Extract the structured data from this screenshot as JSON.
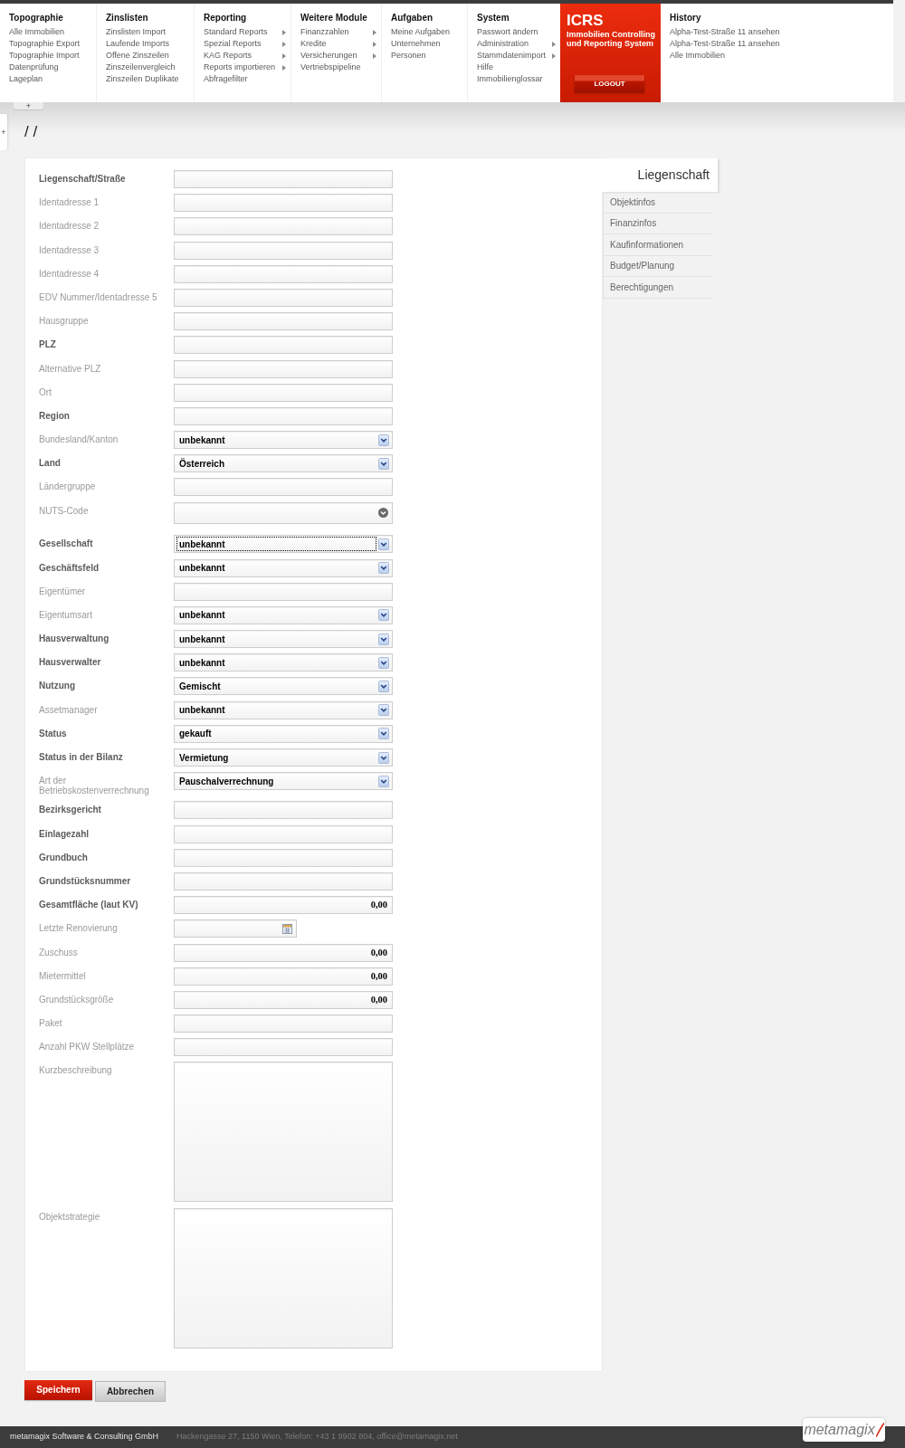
{
  "menu": {
    "columns": [
      {
        "title": "Topographie",
        "items": [
          {
            "label": "Alle Immobilien",
            "submenu": false
          },
          {
            "label": "Topographie Export",
            "submenu": false
          },
          {
            "label": "Topographie Import",
            "submenu": false
          },
          {
            "label": "Datenprüfung",
            "submenu": false
          },
          {
            "label": "Lageplan",
            "submenu": false
          }
        ]
      },
      {
        "title": "Zinslisten",
        "items": [
          {
            "label": "Zinslisten Import",
            "submenu": false
          },
          {
            "label": "Laufende Imports",
            "submenu": false
          },
          {
            "label": "Offene Zinszeilen",
            "submenu": false
          },
          {
            "label": "Zinszeilenvergleich",
            "submenu": false
          },
          {
            "label": "Zinszeilen Duplikate",
            "submenu": false
          }
        ]
      },
      {
        "title": "Reporting",
        "items": [
          {
            "label": "Standard Reports",
            "submenu": true
          },
          {
            "label": "Spezial Reports",
            "submenu": true
          },
          {
            "label": "KAG Reports",
            "submenu": true
          },
          {
            "label": "Reports importieren",
            "submenu": true
          },
          {
            "label": "Abfragefilter",
            "submenu": false
          }
        ]
      },
      {
        "title": "Weitere Module",
        "items": [
          {
            "label": "Finanzzahlen",
            "submenu": true
          },
          {
            "label": "Kredite",
            "submenu": true
          },
          {
            "label": "Versicherungen",
            "submenu": true
          },
          {
            "label": "Vertriebspipeline",
            "submenu": false
          }
        ]
      },
      {
        "title": "Aufgaben",
        "items": [
          {
            "label": "Meine Aufgaben",
            "submenu": false
          },
          {
            "label": "Unternehmen",
            "submenu": false
          },
          {
            "label": "Personen",
            "submenu": false
          }
        ]
      },
      {
        "title": "System",
        "items": [
          {
            "label": "Passwort ändern",
            "submenu": false
          },
          {
            "label": "Administration",
            "submenu": true
          },
          {
            "label": "Stammdatenimport",
            "submenu": true
          },
          {
            "label": "Hilfe",
            "submenu": false
          },
          {
            "label": "Immobilienglossar",
            "submenu": false
          }
        ]
      }
    ],
    "brand": {
      "title": "ICRS",
      "subtitle": "Immobilien Controlling und Reporting System",
      "logout": "LOGOUT"
    },
    "history": {
      "title": "History",
      "items": [
        "Alpha-Test-Straße 11 ansehen",
        "Alpha-Test-Straße 11 ansehen",
        "Alle Immobilien"
      ]
    }
  },
  "add_tab": "+",
  "side_tab": "+",
  "breadcrumb": "/ /",
  "form": {
    "fields": [
      {
        "label": "Liegenschaft/Straße",
        "kind": "text",
        "required": true,
        "focused": false
      },
      {
        "label": "Identadresse 1",
        "kind": "text",
        "required": false,
        "focused": false
      },
      {
        "label": "Identadresse 2",
        "kind": "text",
        "required": false,
        "focused": false
      },
      {
        "label": "Identadresse 3",
        "kind": "text",
        "required": false,
        "focused": false
      },
      {
        "label": "Identadresse 4",
        "kind": "text",
        "required": false,
        "focused": false
      },
      {
        "label": "EDV Nummer/Identadresse 5",
        "kind": "text",
        "required": false,
        "focused": false
      },
      {
        "label": "Hausgruppe",
        "kind": "text",
        "required": false,
        "focused": false
      },
      {
        "label": "PLZ",
        "kind": "text",
        "required": true,
        "focused": false
      },
      {
        "label": "Alternative PLZ",
        "kind": "text",
        "required": false,
        "focused": false
      },
      {
        "label": "Ort",
        "kind": "text",
        "required": false,
        "focused": false
      },
      {
        "label": "Region",
        "kind": "text",
        "required": true,
        "focused": false
      },
      {
        "label": "Bundesland/Kanton",
        "kind": "select",
        "required": false,
        "focused": false,
        "value": "unbekannt"
      },
      {
        "label": "Land",
        "kind": "select",
        "required": true,
        "focused": false,
        "value": "Österreich"
      },
      {
        "label": "Ländergruppe",
        "kind": "text",
        "required": false,
        "focused": false
      },
      {
        "label": "NUTS-Code",
        "kind": "combo",
        "required": false,
        "focused": false
      },
      {
        "label": "Gesellschaft",
        "kind": "select",
        "required": true,
        "focused": true,
        "value": "unbekannt"
      },
      {
        "label": "Geschäftsfeld",
        "kind": "select",
        "required": true,
        "focused": false,
        "value": "unbekannt"
      },
      {
        "label": "Eigentümer",
        "kind": "text",
        "required": false,
        "focused": false
      },
      {
        "label": "Eigentumsart",
        "kind": "select",
        "required": false,
        "focused": false,
        "value": "unbekannt"
      },
      {
        "label": "Hausverwaltung",
        "kind": "select",
        "required": true,
        "focused": false,
        "value": "unbekannt"
      },
      {
        "label": "Hausverwalter",
        "kind": "select",
        "required": true,
        "focused": false,
        "value": "unbekannt"
      },
      {
        "label": "Nutzung",
        "kind": "select",
        "required": true,
        "focused": false,
        "value": "Gemischt"
      },
      {
        "label": "Assetmanager",
        "kind": "select",
        "required": false,
        "focused": false,
        "value": "unbekannt"
      },
      {
        "label": "Status",
        "kind": "select",
        "required": true,
        "focused": false,
        "value": "gekauft"
      },
      {
        "label": "Status in der Bilanz",
        "kind": "select",
        "required": true,
        "focused": false,
        "value": "Vermietung"
      },
      {
        "label": "Art der Betriebskostenverrechnung",
        "kind": "select",
        "required": false,
        "focused": false,
        "value": "Pauschalverrechnung"
      },
      {
        "label": "Bezirksgericht",
        "kind": "text",
        "required": true,
        "focused": false
      },
      {
        "label": "Einlagezahl",
        "kind": "text",
        "required": true,
        "focused": false
      },
      {
        "label": "Grundbuch",
        "kind": "text",
        "required": true,
        "focused": false
      },
      {
        "label": "Grundstücksnummer",
        "kind": "text",
        "required": true,
        "focused": false
      },
      {
        "label": "Gesamtfläche (laut KV)",
        "kind": "number",
        "required": true,
        "focused": false,
        "value": "0,00"
      },
      {
        "label": "Letzte Renovierung",
        "kind": "date",
        "required": false,
        "focused": false
      },
      {
        "label": "Zuschuss",
        "kind": "number",
        "required": false,
        "focused": false,
        "value": "0,00"
      },
      {
        "label": "Mietermittel",
        "kind": "number",
        "required": false,
        "focused": false,
        "value": "0,00"
      },
      {
        "label": "Grundstücksgröße",
        "kind": "number",
        "required": false,
        "focused": false,
        "value": "0,00"
      },
      {
        "label": "Paket",
        "kind": "text",
        "required": false,
        "focused": false
      },
      {
        "label": "Anzahl PKW Stellplätze",
        "kind": "text",
        "required": false,
        "focused": false
      },
      {
        "label": "Kurzbeschreibung",
        "kind": "textarea",
        "required": false,
        "focused": false
      },
      {
        "label": "Objektstrategie",
        "kind": "textarea",
        "required": false,
        "focused": false
      }
    ]
  },
  "tabs": [
    {
      "label": "Liegenschaft",
      "selected": true
    },
    {
      "label": "Objektinfos",
      "selected": false
    },
    {
      "label": "Finanzinfos",
      "selected": false
    },
    {
      "label": "Kaufinformationen",
      "selected": false
    },
    {
      "label": "Budget/Planung",
      "selected": false
    },
    {
      "label": "Berechtigungen",
      "selected": false
    }
  ],
  "actions": [
    {
      "label": "Speichern",
      "kind": "primary"
    },
    {
      "label": "Abbrechen",
      "kind": "secondary"
    }
  ],
  "footer": {
    "company": "metamagix Software & Consulting GmbH",
    "address": "Hackengasse 27, 1150 Wien, Telefon: +43 1 9902 804, office@metamagix.net",
    "logo": "metamagix"
  }
}
